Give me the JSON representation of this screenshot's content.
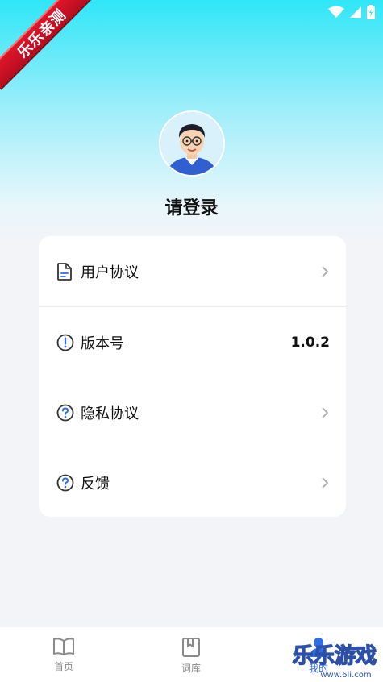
{
  "ribbon": {
    "text": "乐乐亲测"
  },
  "profile": {
    "title": "请登录"
  },
  "menu": {
    "items": [
      {
        "label": "用户协议",
        "icon": "document-icon",
        "value": ""
      },
      {
        "label": "版本号",
        "icon": "info-icon",
        "value": "1.0.2"
      },
      {
        "label": "隐私协议",
        "icon": "help-icon",
        "value": ""
      },
      {
        "label": "反馈",
        "icon": "help-icon",
        "value": ""
      }
    ]
  },
  "tabbar": {
    "tabs": [
      {
        "label": "首页",
        "icon": "book-open-icon"
      },
      {
        "label": "词库",
        "icon": "bookmark-icon"
      },
      {
        "label": "我的",
        "icon": "user-icon"
      }
    ]
  },
  "watermark": {
    "text": "乐乐游戏",
    "url": "www.6li.com"
  },
  "colors": {
    "accent": "#2fe6f7",
    "ribbon": "#d3142a"
  }
}
